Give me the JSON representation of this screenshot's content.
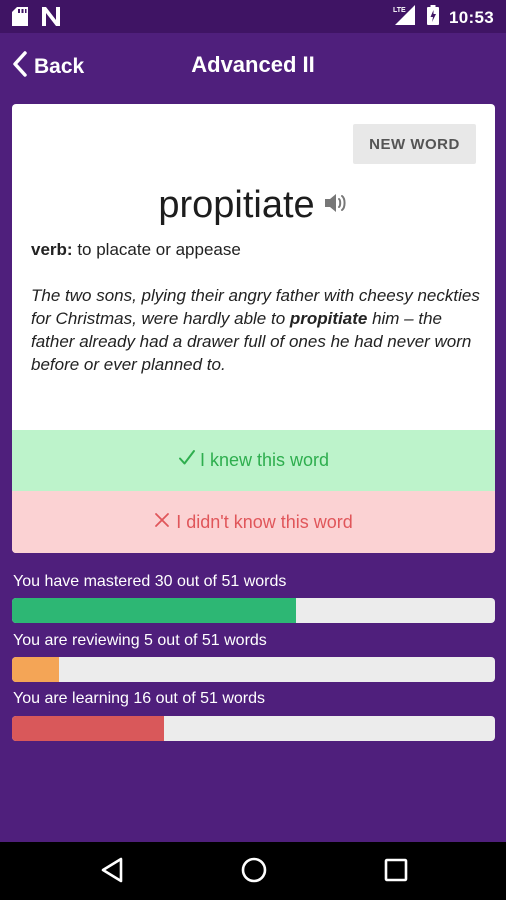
{
  "status_bar": {
    "time": "10:53",
    "network": "LTE",
    "icons": [
      "sd-card-icon",
      "n-notification-icon",
      "signal-icon",
      "battery-icon"
    ]
  },
  "app_bar": {
    "back_label": "Back",
    "title": "Advanced II"
  },
  "card": {
    "new_word_label": "NEW WORD",
    "word": "propitiate",
    "part_of_speech": "verb:",
    "definition": "to placate or appease",
    "example_before": "The two sons, plying their angry father with cheesy neckties for Christmas, were hardly able to ",
    "example_word": "propitiate",
    "example_after": " him – the father already had a drawer full of ones he had never worn before or ever planned to.",
    "knew_label": "I knew this word",
    "didnt_know_label": "I didn't know this word"
  },
  "progress": [
    {
      "label": "You have mastered 30 out of 51 words",
      "value": 30,
      "total": 51,
      "color": "#2db774"
    },
    {
      "label": "You are reviewing 5 out of 51 words",
      "value": 5,
      "total": 51,
      "color": "#f4a556"
    },
    {
      "label": "You are learning 16 out of 51 words",
      "value": 16,
      "total": 51,
      "color": "#d9585a"
    }
  ],
  "colors": {
    "background": "#4f1f7c",
    "status_bar": "#3f1464",
    "knew_bg": "#bdf3cb",
    "knew_text": "#2eae4e",
    "didnt_bg": "#fbd2d3",
    "didnt_text": "#e0565a"
  }
}
